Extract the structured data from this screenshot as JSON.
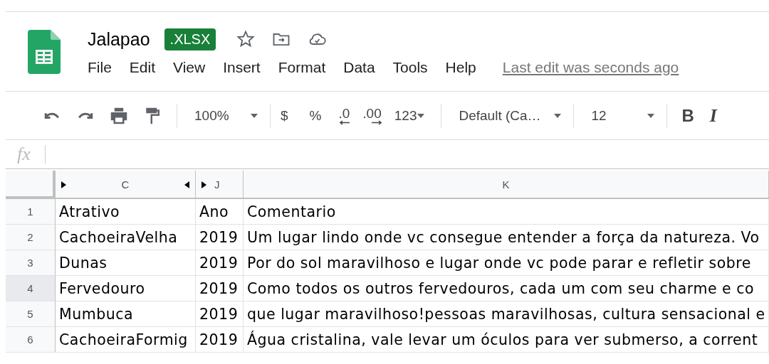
{
  "document": {
    "title": "Jalapao",
    "badge": ".XLSX"
  },
  "menu": [
    {
      "label": "File"
    },
    {
      "label": "Edit"
    },
    {
      "label": "View"
    },
    {
      "label": "Insert"
    },
    {
      "label": "Format"
    },
    {
      "label": "Data"
    },
    {
      "label": "Tools"
    },
    {
      "label": "Help"
    }
  ],
  "last_edit": "Last edit was seconds ago",
  "toolbar": {
    "zoom": "100%",
    "currency": "$",
    "percent": "%",
    "decrease_decimals": ".0",
    "increase_decimals": ".00",
    "number_format": "123",
    "font": "Default (Ca…",
    "font_size": "12",
    "bold": "B",
    "italic": "I"
  },
  "formula_bar": {
    "label": "fx"
  },
  "sheet": {
    "columns": [
      {
        "label": "C",
        "hidden_before": true,
        "hidden_after": true
      },
      {
        "label": "J",
        "hidden_before": true,
        "hidden_after": false
      },
      {
        "label": "K",
        "hidden_before": false,
        "hidden_after": false
      }
    ],
    "rows": [
      {
        "number": "1",
        "selected": false,
        "cells": [
          "Atrativo",
          "Ano",
          "Comentario"
        ]
      },
      {
        "number": "2",
        "selected": false,
        "cells": [
          "CachoeiraVelha",
          "2019",
          "Um lugar lindo onde vc consegue entender a força da natureza. Vo"
        ]
      },
      {
        "number": "3",
        "selected": false,
        "cells": [
          "Dunas",
          "2019",
          "Por do sol maravilhoso e lugar onde vc pode parar e refletir sobre"
        ]
      },
      {
        "number": "4",
        "selected": true,
        "cells": [
          "Fervedouro",
          "2019",
          "Como todos os outros fervedouros, cada um com seu charme e co"
        ]
      },
      {
        "number": "5",
        "selected": false,
        "cells": [
          "Mumbuca",
          "2019",
          "que lugar maravilhoso!pessoas maravilhosas, cultura sensacional e"
        ]
      },
      {
        "number": "6",
        "selected": false,
        "cells": [
          "CachoeiraFormig",
          "2019",
          "Água cristalina, vale levar um óculos para ver submerso, a corrent"
        ]
      }
    ]
  }
}
